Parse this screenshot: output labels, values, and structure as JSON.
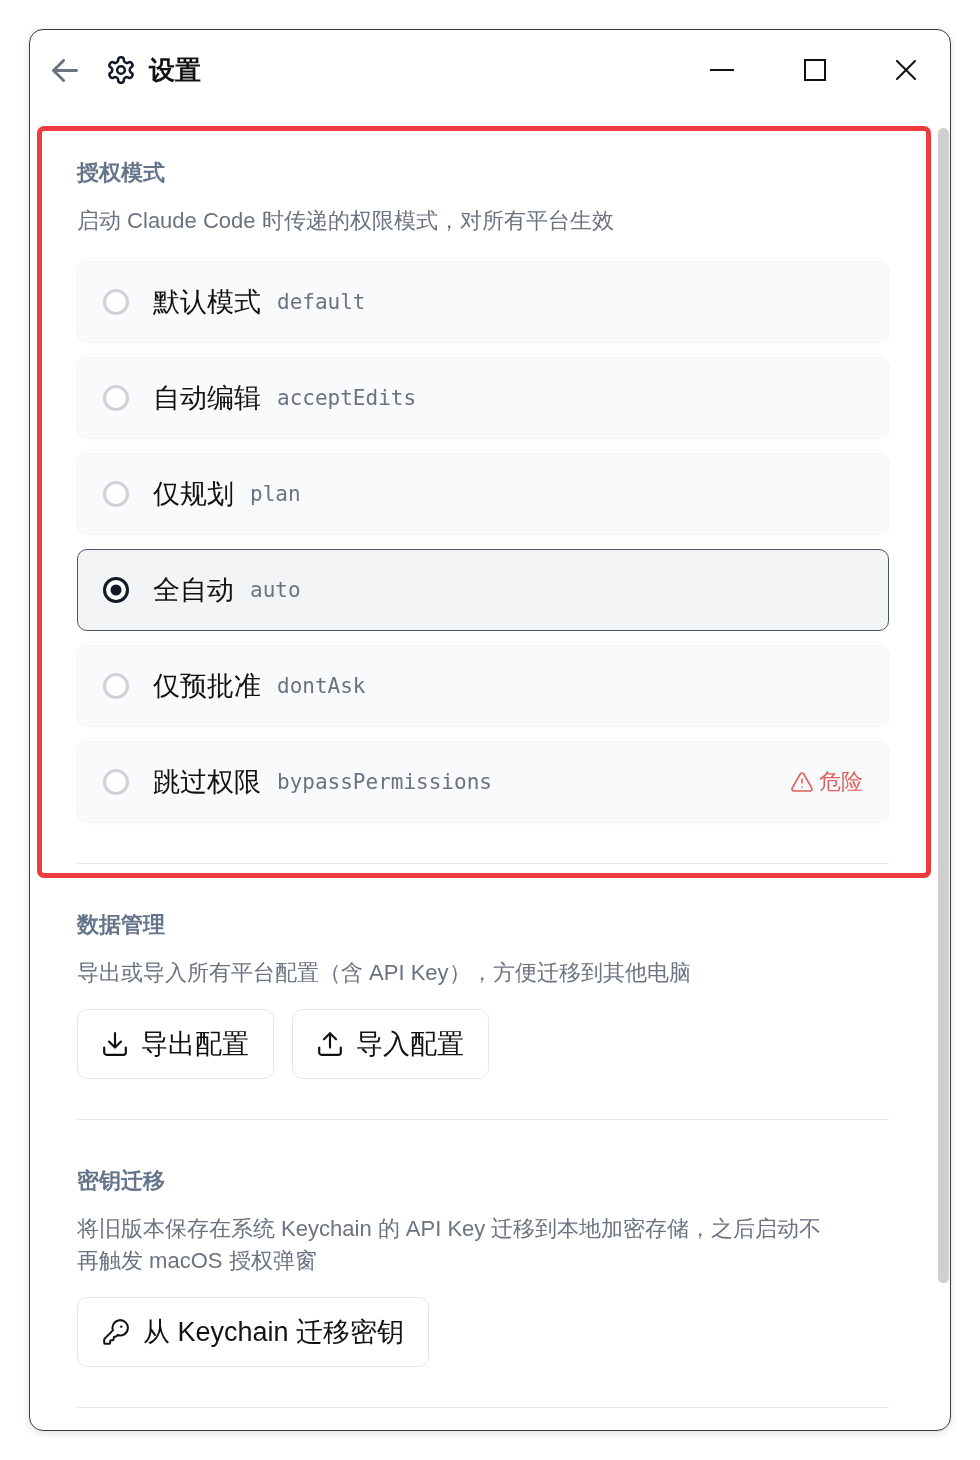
{
  "window": {
    "title": "设置"
  },
  "sections": [
    {
      "kind": "radio_list",
      "title": "授权模式",
      "description": "启动 Claude Code 时传递的权限模式，对所有平台生效",
      "highlighted": true,
      "options": [
        {
          "label": "默认模式",
          "value": "default",
          "selected": false
        },
        {
          "label": "自动编辑",
          "value": "acceptEdits",
          "selected": false
        },
        {
          "label": "仅规划",
          "value": "plan",
          "selected": false
        },
        {
          "label": "全自动",
          "value": "auto",
          "selected": true
        },
        {
          "label": "仅预批准",
          "value": "dontAsk",
          "selected": false
        },
        {
          "label": "跳过权限",
          "value": "bypassPermissions",
          "selected": false,
          "warning": "危险"
        }
      ]
    },
    {
      "kind": "buttons",
      "title": "数据管理",
      "description": "导出或导入所有平台配置（含 API Key），方便迁移到其他电脑",
      "highlighted": false,
      "buttons": [
        {
          "kind": "export",
          "label": "导出配置"
        },
        {
          "kind": "import",
          "label": "导入配置"
        }
      ]
    },
    {
      "kind": "buttons",
      "title": "密钥迁移",
      "description": "将旧版本保存在系统 Keychain 的 API Key 迁移到本地加密存储，之后启动不再触发 macOS 授权弹窗",
      "highlighted": false,
      "buttons": [
        {
          "kind": "migrate",
          "label": "从 Keychain 迁移密钥"
        }
      ]
    }
  ]
}
